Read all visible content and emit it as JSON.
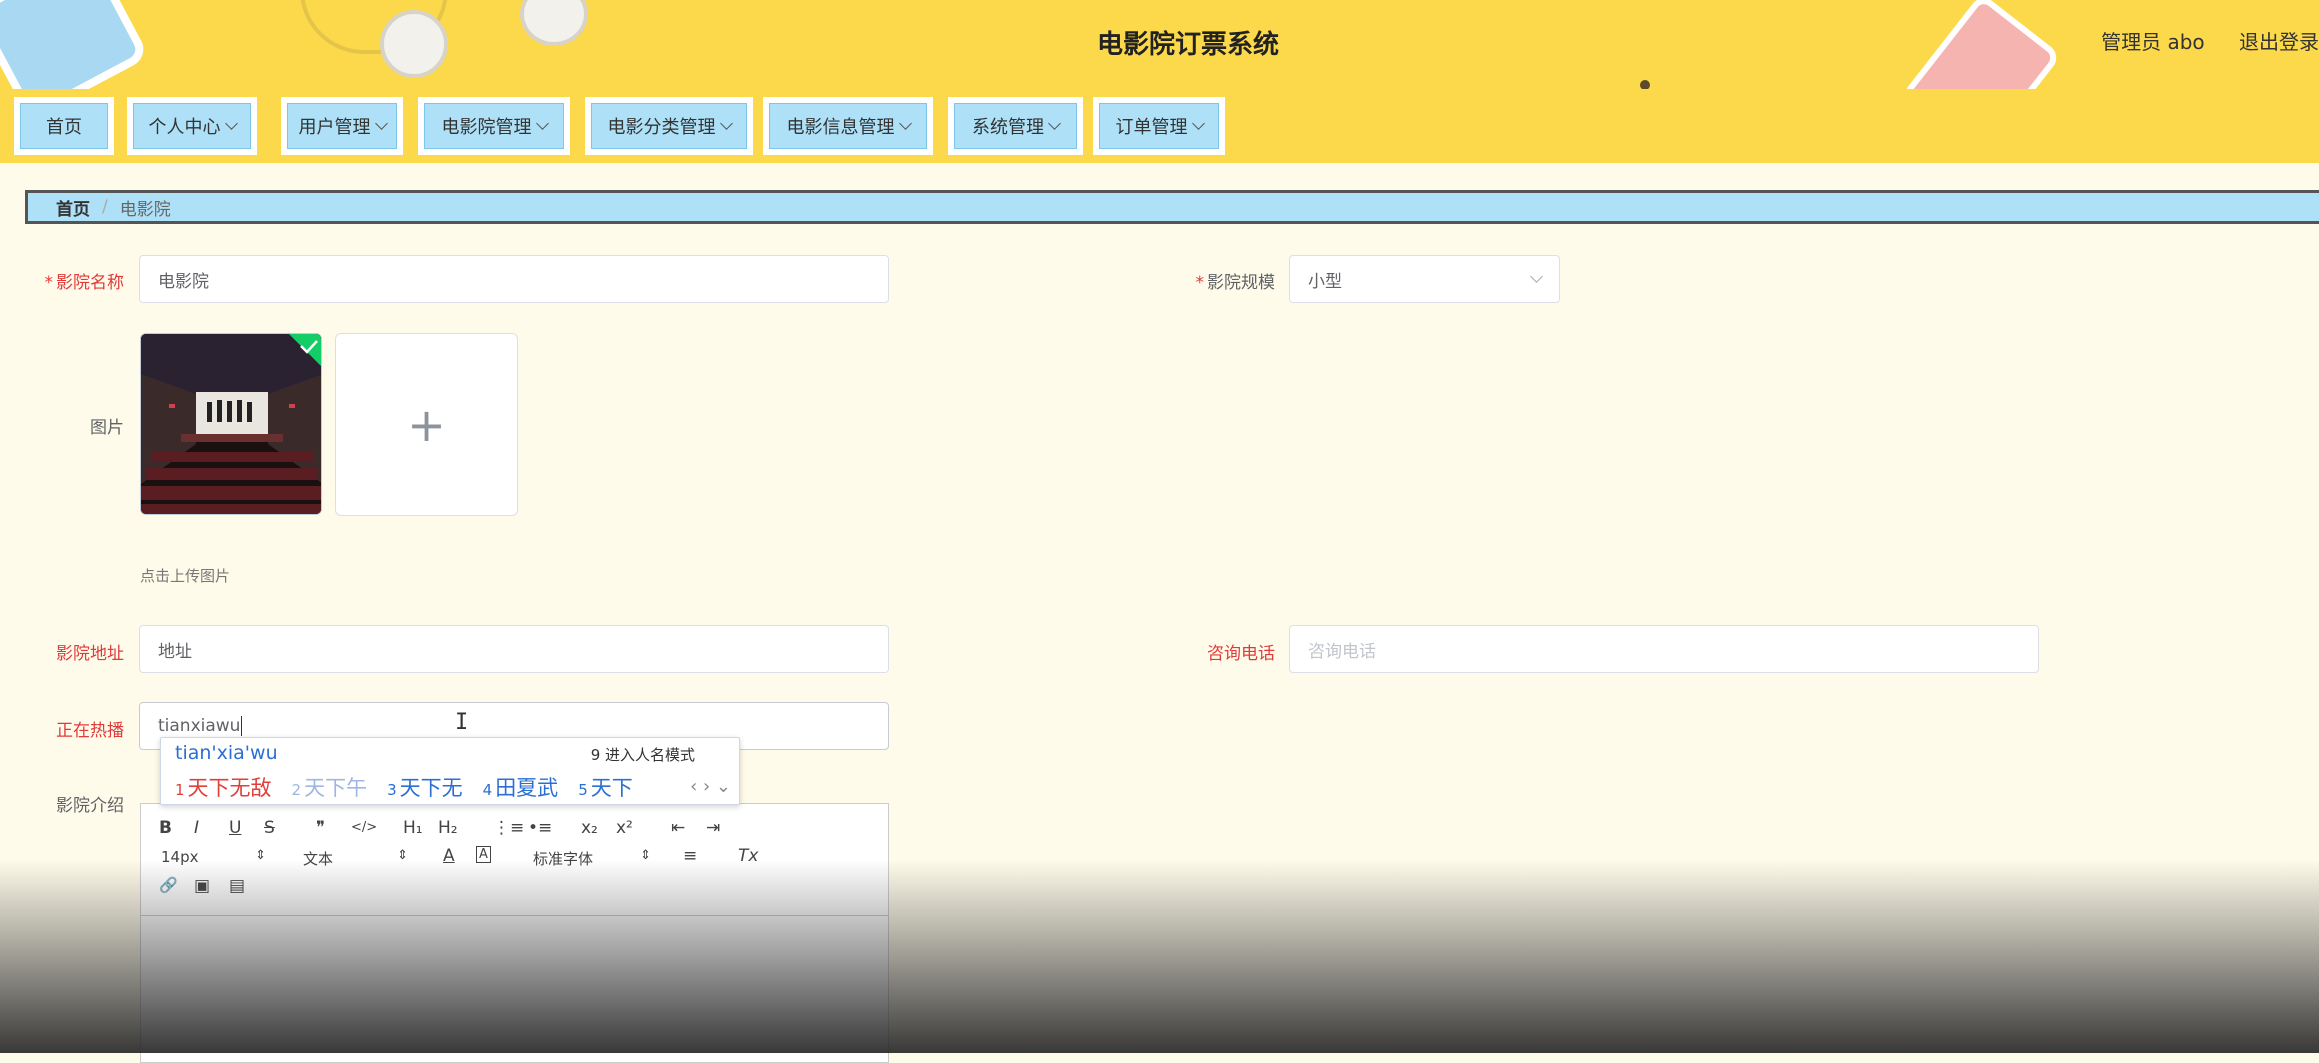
{
  "header": {
    "title": "电影院订票系统",
    "user": "管理员 abo",
    "logout": "退出登录"
  },
  "nav": [
    {
      "label": "首页",
      "dropdown": false
    },
    {
      "label": "个人中心",
      "dropdown": true
    },
    {
      "label": "用户管理",
      "dropdown": true
    },
    {
      "label": "电影院管理",
      "dropdown": true
    },
    {
      "label": "电影分类管理",
      "dropdown": true
    },
    {
      "label": "电影信息管理",
      "dropdown": true
    },
    {
      "label": "系统管理",
      "dropdown": true
    },
    {
      "label": "订单管理",
      "dropdown": true
    }
  ],
  "breadcrumb": {
    "home": "首页",
    "sep": "/",
    "current": "电影院"
  },
  "form": {
    "name_label": "影院名称",
    "name_value": "电影院",
    "scale_label": "影院规模",
    "scale_value": "小型",
    "image_label": "图片",
    "upload_plus": "+",
    "upload_hint": "点击上传图片",
    "address_label": "影院地址",
    "address_value": "地址",
    "phone_label": "咨询电话",
    "phone_placeholder": "咨询电话",
    "showing_label": "正在热播",
    "showing_value": "tianxiawu",
    "intro_label": "影院介绍",
    "required_mark": "*"
  },
  "ime": {
    "composition": "tian'xia'wu",
    "mode_hint": "9 进入人名模式",
    "candidates": [
      {
        "num": "1",
        "text": "天下无敌"
      },
      {
        "num": "2",
        "text": "天下午"
      },
      {
        "num": "3",
        "text": "天下无"
      },
      {
        "num": "4",
        "text": "田夏武"
      },
      {
        "num": "5",
        "text": "天下"
      }
    ],
    "nav": "‹ › ⌄"
  },
  "editor": {
    "font_size": "14px",
    "block_type": "文本",
    "font_family": "标准字体",
    "buttons": {
      "bold": "B",
      "italic": "I",
      "underline": "U",
      "strike": "S",
      "quote": "❞",
      "code": "</>",
      "h1": "H₁",
      "h2": "H₂",
      "ol": "⋮≡",
      "ul": "•≡",
      "sub": "x₂",
      "sup": "x²",
      "outdent": "⇤",
      "indent": "⇥",
      "color": "A",
      "bg": "A",
      "align": "≡",
      "clean": "Tx",
      "link": "🔗",
      "image": "▣",
      "video": "▤"
    }
  }
}
